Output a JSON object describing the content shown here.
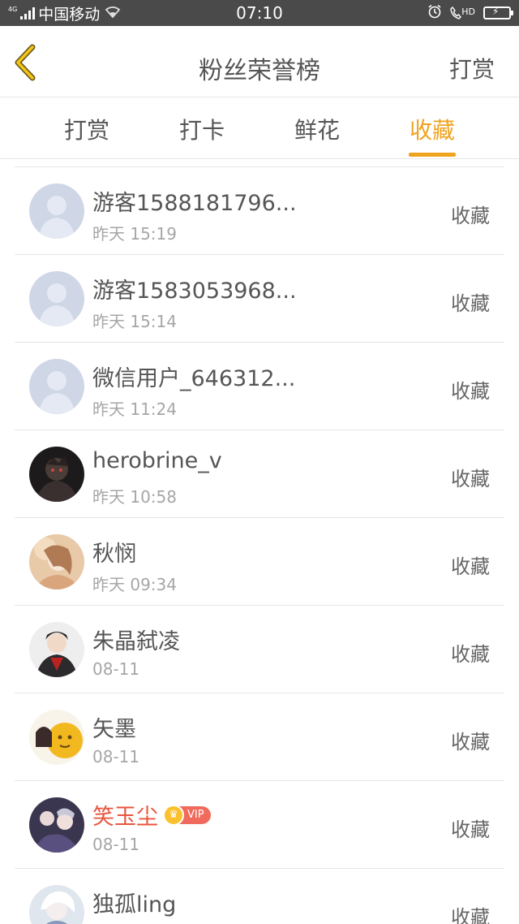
{
  "status_bar": {
    "network_type": "4G",
    "carrier": "中国移动",
    "time": "07:10",
    "hd_label": "HD",
    "battery_color": "#3ddc35"
  },
  "header": {
    "title": "粉丝荣誉榜",
    "action_label": "打赏"
  },
  "tabs": [
    {
      "label": "打赏",
      "active": false
    },
    {
      "label": "打卡",
      "active": false
    },
    {
      "label": "鲜花",
      "active": false
    },
    {
      "label": "收藏",
      "active": true
    }
  ],
  "accent_color": "#f0a31e",
  "vip_name_color": "#e8553e",
  "list": [
    {
      "name": "游客1588181796...",
      "time": "昨天 15:19",
      "action": "收藏",
      "avatar": "default-avatar"
    },
    {
      "name": "游客1583053968...",
      "time": "昨天 15:14",
      "action": "收藏",
      "avatar": "default-avatar"
    },
    {
      "name": "微信用户_646312...",
      "time": "昨天 11:24",
      "action": "收藏",
      "avatar": "default-avatar"
    },
    {
      "name": "herobrine_v",
      "time": "昨天 10:58",
      "action": "收藏",
      "avatar": "user-photo-avatar"
    },
    {
      "name": "秋悯",
      "time": "昨天 09:34",
      "action": "收藏",
      "avatar": "user-photo-avatar"
    },
    {
      "name": "朱晶弑凌",
      "time": "08-11",
      "action": "收藏",
      "avatar": "user-photo-avatar"
    },
    {
      "name": "矢墨",
      "time": "08-11",
      "action": "收藏",
      "avatar": "user-photo-avatar"
    },
    {
      "name": "笑玉尘",
      "time": "08-11",
      "action": "收藏",
      "avatar": "user-photo-avatar",
      "vip": "VIP"
    },
    {
      "name": "独孤ling",
      "time": "",
      "action": "收藏",
      "avatar": "user-photo-avatar"
    }
  ]
}
